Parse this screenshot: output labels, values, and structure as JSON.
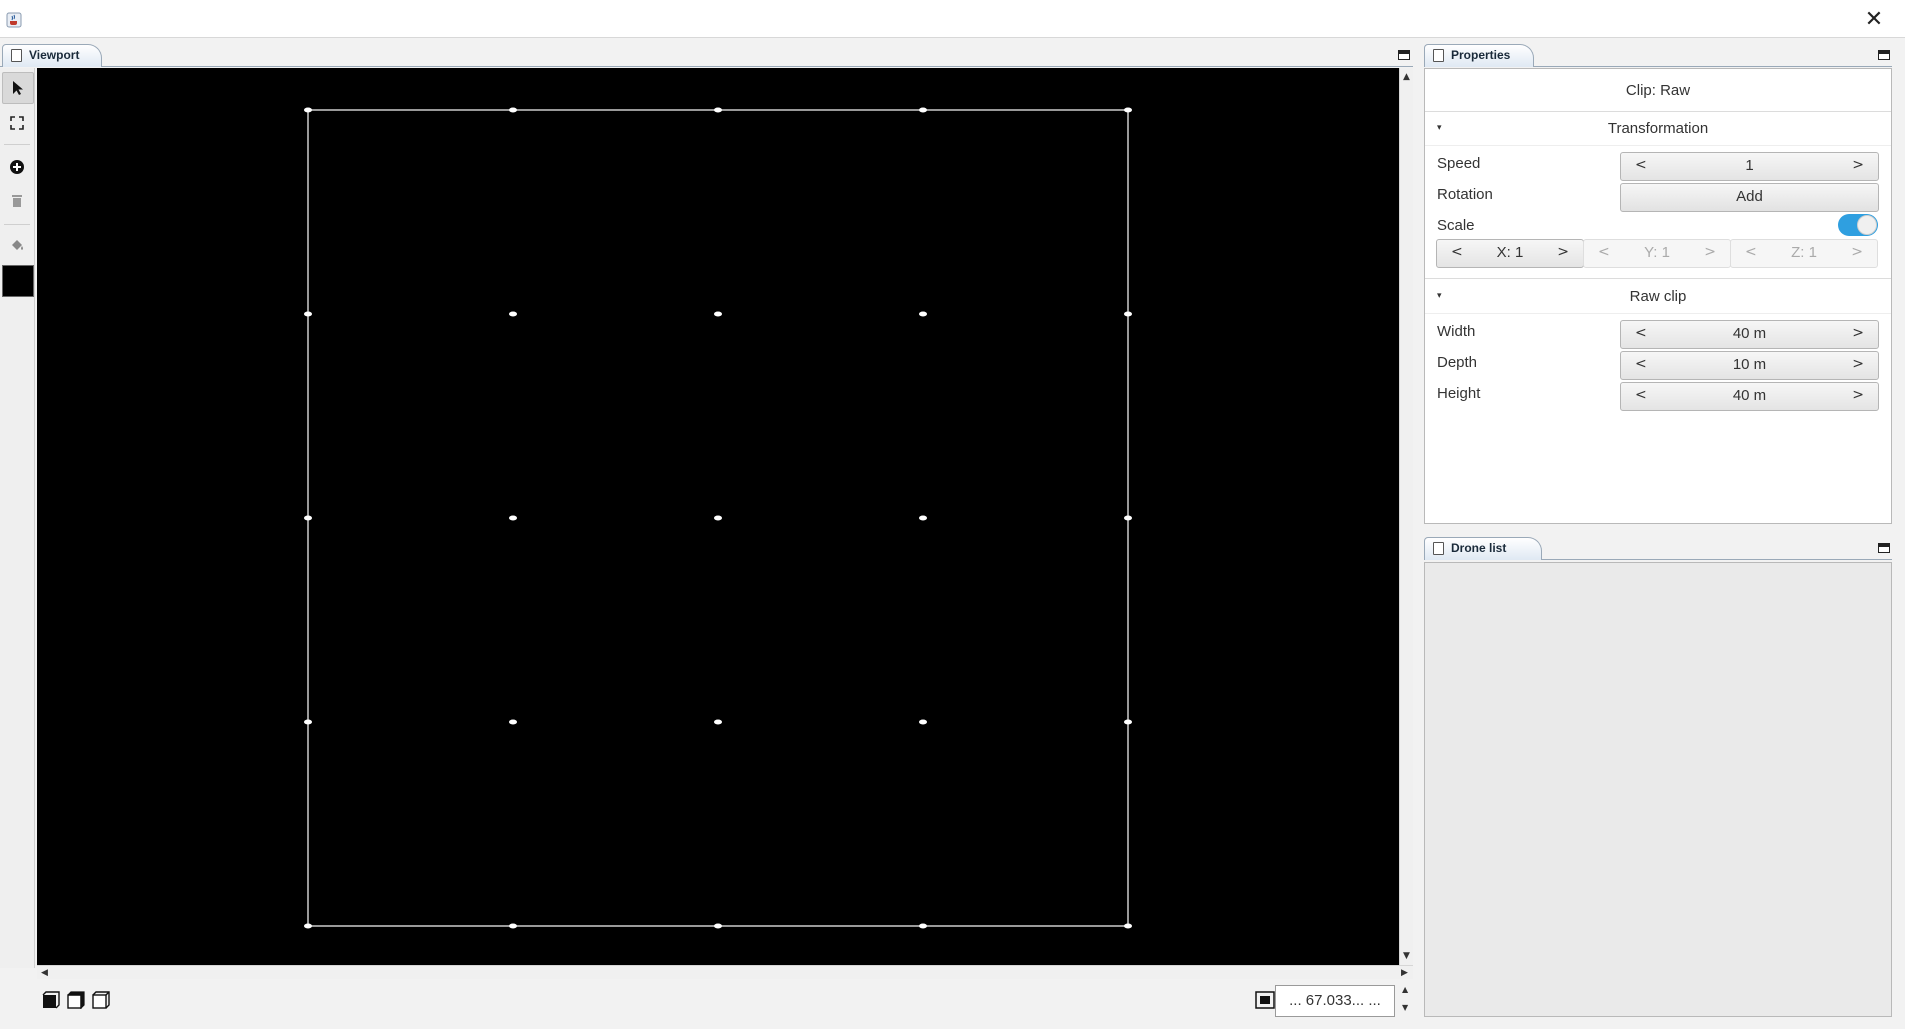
{
  "window": {
    "close_symbol": "✕",
    "app_icon": "java-cup-icon"
  },
  "viewport": {
    "tab_label": "Viewport",
    "toolbar": {
      "tools": [
        "select-arrow-icon",
        "fit-frame-icon",
        "add-drone-icon",
        "delete-trash-icon",
        "paint-bucket-icon",
        "color-swatch"
      ],
      "swatch_color": "#000000"
    },
    "canvas": {
      "background": "#000000",
      "frame_color": "#ffffff",
      "grid_columns": 5,
      "grid_rows": 5
    },
    "view_buttons": [
      "front-view-icon",
      "side-view-icon",
      "top-view-icon"
    ],
    "zoom_value": "... 67.033... ..."
  },
  "properties": {
    "tab_label": "Properties",
    "clip_title": "Clip: Raw",
    "transformation": {
      "header": "Transformation",
      "speed_label": "Speed",
      "speed_value": "1",
      "rotation_label": "Rotation",
      "rotation_button": "Add",
      "scale_label": "Scale",
      "scale_uniform_toggle": true,
      "scale_x": "X: 1",
      "scale_y": "Y: 1",
      "scale_z": "Z: 1"
    },
    "raw_clip": {
      "header": "Raw clip",
      "width_label": "Width",
      "width_value": "40 m",
      "depth_label": "Depth",
      "depth_value": "10 m",
      "height_label": "Height",
      "height_value": "40 m"
    },
    "spinner_left": "<",
    "spinner_right": ">"
  },
  "drone_list": {
    "tab_label": "Drone list",
    "items": []
  },
  "colors": {
    "accent_toggle": "#2f9fe0",
    "tab_gradient_end": "#dfe9f3"
  }
}
